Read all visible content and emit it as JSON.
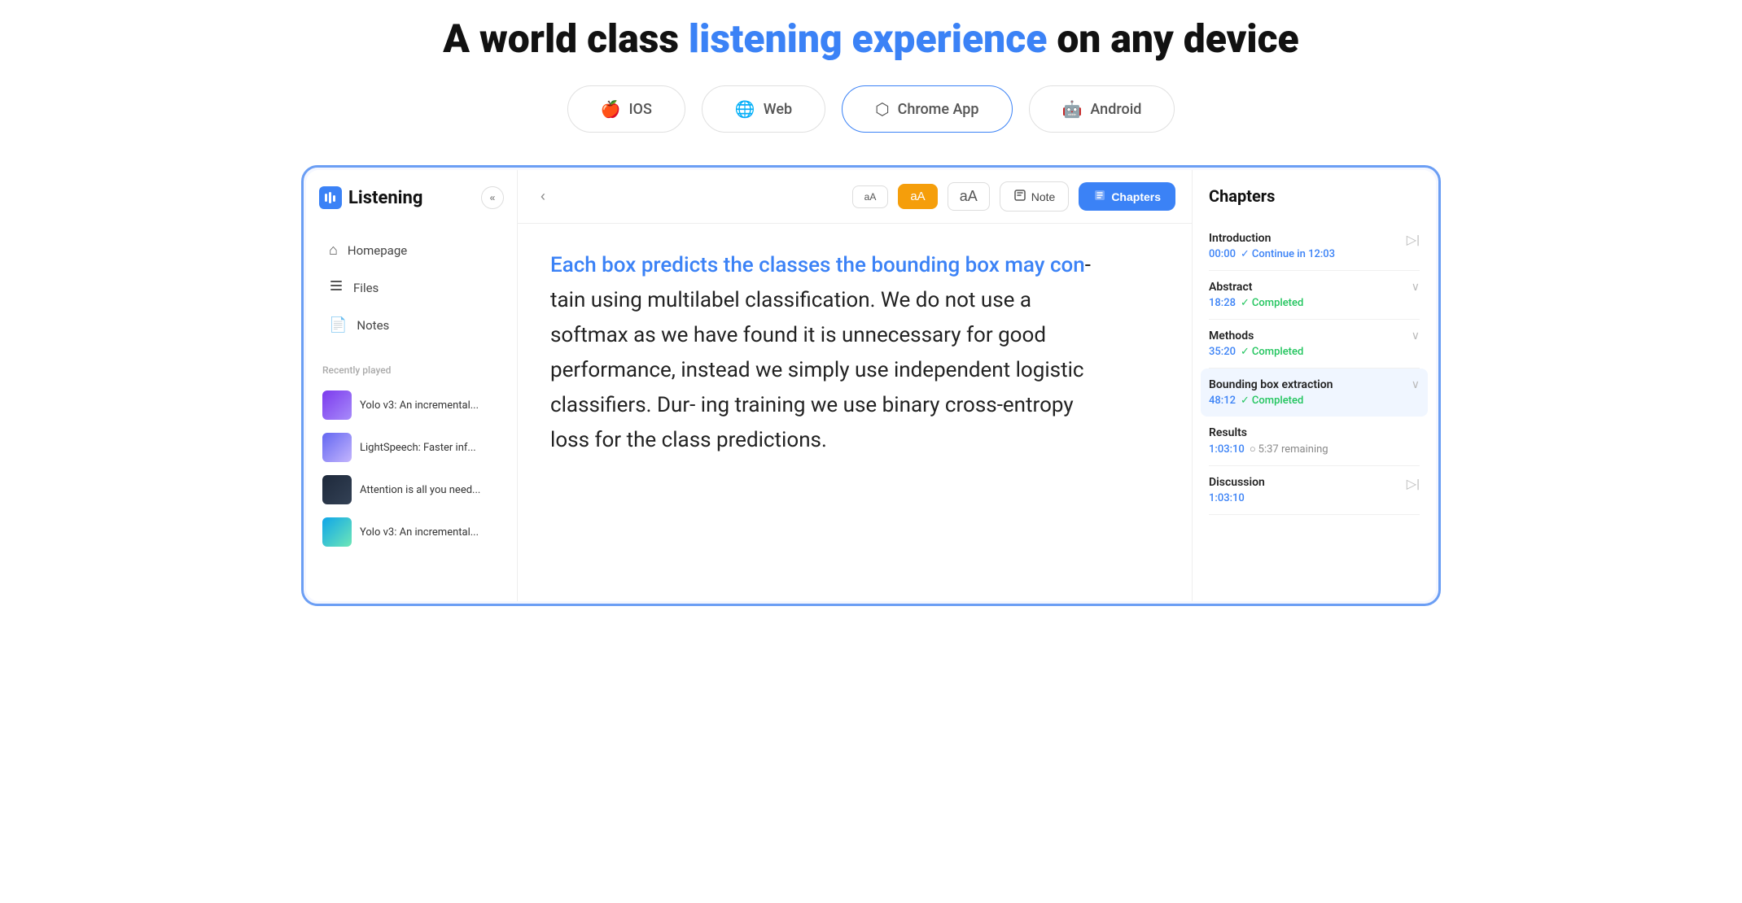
{
  "hero": {
    "heading_plain": "A world class ",
    "heading_highlight": "listening experience",
    "heading_suffix": " on any device"
  },
  "platforms": [
    {
      "id": "ios",
      "label": "IOS",
      "icon": "🍎"
    },
    {
      "id": "web",
      "label": "Web",
      "icon": "🌐"
    },
    {
      "id": "chrome",
      "label": "Chrome App",
      "icon": "⬡",
      "active": true
    },
    {
      "id": "android",
      "label": "Android",
      "icon": "🤖"
    }
  ],
  "sidebar": {
    "logo_text": "Listening",
    "collapse_icon": "«",
    "nav_items": [
      {
        "id": "homepage",
        "label": "Homepage",
        "icon": "⌂"
      },
      {
        "id": "files",
        "label": "Files",
        "icon": "⊞"
      },
      {
        "id": "notes",
        "label": "Notes",
        "icon": "📄"
      }
    ],
    "recently_played_label": "Recently played",
    "recent_items": [
      {
        "id": "yolo-v3-1",
        "label": "Yolo v3: An incremental...",
        "thumb": "thumb-purple"
      },
      {
        "id": "lightspeech",
        "label": "LightSpeech: Faster inf...",
        "thumb": "thumb-blue-purple"
      },
      {
        "id": "attention",
        "label": "Attention is all you need...",
        "thumb": "thumb-dark"
      },
      {
        "id": "yolo-v3-2",
        "label": "Yolo v3: An incremental...",
        "thumb": "thumb-teal"
      }
    ]
  },
  "toolbar": {
    "back_label": "‹",
    "font_small": "aA",
    "font_medium": "aA",
    "font_large": "aA",
    "note_label": "Note",
    "chapters_label": "Chapters"
  },
  "reading": {
    "text_highlighted": "Each box predicts the classes the bounding box may con",
    "text_plain": "- tain using multilabel classification. We do not use a softmax as we have found it is unnecessary for good performance, instead we simply use independent logistic classifiers. Dur- ing training we use binary cross-entropy loss for the class predictions."
  },
  "chapters": {
    "title": "Chapters",
    "items": [
      {
        "id": "introduction",
        "name": "Introduction",
        "time": "00:00",
        "status_type": "continue",
        "status_label": "Continue in 12:03"
      },
      {
        "id": "abstract",
        "name": "Abstract",
        "time": "18:28",
        "status_type": "completed",
        "status_label": "Completed"
      },
      {
        "id": "methods",
        "name": "Methods",
        "time": "35:20",
        "status_type": "completed",
        "status_label": "Completed"
      },
      {
        "id": "bounding",
        "name": "Bounding box extraction",
        "time": "48:12",
        "status_type": "completed",
        "status_label": "Completed",
        "active": true
      },
      {
        "id": "results",
        "name": "Results",
        "time": "1:03:10",
        "status_type": "remaining",
        "status_label": "5:37 remaining"
      },
      {
        "id": "discussion",
        "name": "Discussion",
        "time": "1:03:10",
        "status_type": "none",
        "status_label": ""
      }
    ]
  }
}
